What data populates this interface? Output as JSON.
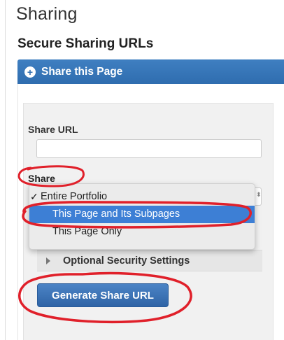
{
  "page": {
    "title": "Sharing",
    "section_title": "Secure Sharing URLs"
  },
  "panel": {
    "header_label": "Share this Page",
    "header_icon": "plus-circle-icon"
  },
  "form": {
    "share_url_label": "Share URL",
    "share_url_value": "",
    "share_label": "Share",
    "options": [
      {
        "label": "Entire Portfolio",
        "checked": true,
        "highlighted": false
      },
      {
        "label": "This Page and Its Subpages",
        "checked": false,
        "highlighted": true
      },
      {
        "label": "This Page Only",
        "checked": false,
        "highlighted": false
      }
    ],
    "check_glyph": "✓",
    "optional_settings_label": "Optional Security Settings",
    "generate_button_label": "Generate Share URL"
  },
  "colors": {
    "header_blue": "#2f6daf",
    "highlight_blue": "#3d7fd5",
    "annotation_red": "#e0202a"
  }
}
